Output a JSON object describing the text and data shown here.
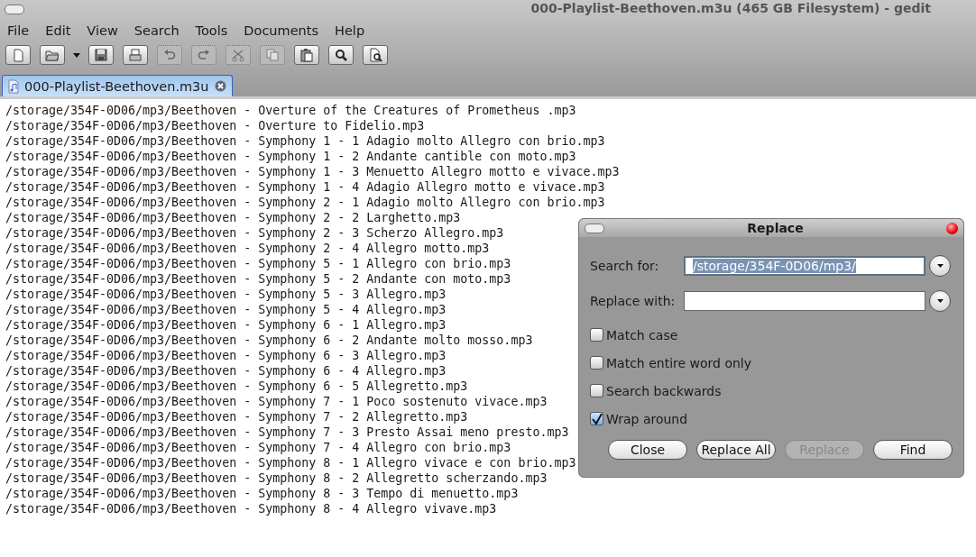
{
  "window": {
    "title": "000-Playlist-Beethoven.m3u (465 GB Filesystem) - gedit"
  },
  "menu": [
    "File",
    "Edit",
    "View",
    "Search",
    "Tools",
    "Documents",
    "Help"
  ],
  "toolbar": [
    {
      "kind": "new",
      "disabled": false
    },
    {
      "kind": "open",
      "disabled": false
    },
    {
      "kind": "dropdown",
      "disabled": false
    },
    {
      "kind": "save",
      "disabled": false
    },
    {
      "kind": "print",
      "disabled": false
    },
    {
      "kind": "undo",
      "disabled": true
    },
    {
      "kind": "redo",
      "disabled": true
    },
    {
      "kind": "cut",
      "disabled": true
    },
    {
      "kind": "copy",
      "disabled": true
    },
    {
      "kind": "paste",
      "disabled": false
    },
    {
      "kind": "find",
      "disabled": false
    },
    {
      "kind": "find-file",
      "disabled": false
    }
  ],
  "tabs": [
    {
      "label": "000-Playlist-Beethoven.m3u",
      "selected": true
    }
  ],
  "editor": {
    "lines": [
      "/storage/354F-0D06/mp3/Beethoven - Overture of the Creatures of Prometheus .mp3",
      "/storage/354F-0D06/mp3/Beethoven - Overture to Fidelio.mp3",
      "/storage/354F-0D06/mp3/Beethoven - Symphony 1 - 1 Adagio molto Allegro con brio.mp3",
      "/storage/354F-0D06/mp3/Beethoven - Symphony 1 - 2 Andante cantible con moto.mp3",
      "/storage/354F-0D06/mp3/Beethoven - Symphony 1 - 3 Menuetto Allegro motto e vivace.mp3",
      "/storage/354F-0D06/mp3/Beethoven - Symphony 1 - 4 Adagio Allegro motto e vivace.mp3",
      "/storage/354F-0D06/mp3/Beethoven - Symphony 2 - 1 Adagio molto Allegro con brio.mp3",
      "/storage/354F-0D06/mp3/Beethoven - Symphony 2 - 2 Larghetto.mp3",
      "/storage/354F-0D06/mp3/Beethoven - Symphony 2 - 3 Scherzo Allegro.mp3",
      "/storage/354F-0D06/mp3/Beethoven - Symphony 2 - 4 Allegro motto.mp3",
      "/storage/354F-0D06/mp3/Beethoven - Symphony 5 - 1 Allegro con brio.mp3",
      "/storage/354F-0D06/mp3/Beethoven - Symphony 5 - 2 Andante con moto.mp3",
      "/storage/354F-0D06/mp3/Beethoven - Symphony 5 - 3 Allegro.mp3",
      "/storage/354F-0D06/mp3/Beethoven - Symphony 5 - 4 Allegro.mp3",
      "/storage/354F-0D06/mp3/Beethoven - Symphony 6 - 1 Allegro.mp3",
      "/storage/354F-0D06/mp3/Beethoven - Symphony 6 - 2 Andante molto mosso.mp3",
      "/storage/354F-0D06/mp3/Beethoven - Symphony 6 - 3 Allegro.mp3",
      "/storage/354F-0D06/mp3/Beethoven - Symphony 6 - 4 Allegro.mp3",
      "/storage/354F-0D06/mp3/Beethoven - Symphony 6 - 5 Allegretto.mp3",
      "/storage/354F-0D06/mp3/Beethoven - Symphony 7 - 1 Poco sostenuto vivace.mp3",
      "/storage/354F-0D06/mp3/Beethoven - Symphony 7 - 2 Allegretto.mp3",
      "/storage/354F-0D06/mp3/Beethoven - Symphony 7 - 3 Presto Assai meno presto.mp3",
      "/storage/354F-0D06/mp3/Beethoven - Symphony 7 - 4 Allegro con brio.mp3",
      "/storage/354F-0D06/mp3/Beethoven - Symphony 8 - 1 Allegro vivace e con brio.mp3",
      "/storage/354F-0D06/mp3/Beethoven - Symphony 8 - 2 Allegretto scherzando.mp3",
      "/storage/354F-0D06/mp3/Beethoven - Symphony 8 - 3 Tempo di menuetto.mp3",
      "/storage/354F-0D06/mp3/Beethoven - Symphony 8 - 4 Allegro vivave.mp3"
    ]
  },
  "dialog": {
    "title": "Replace",
    "fields": [
      {
        "label": "Search for:",
        "value": "/storage/354F-0D06/mp3/",
        "focused": true
      },
      {
        "label": "Replace with:",
        "focused": false
      }
    ],
    "options": [
      {
        "label": "Match case",
        "checked": false
      },
      {
        "label": "Match entire word only",
        "checked": false
      },
      {
        "label": "Search backwards",
        "checked": false
      },
      {
        "label": "Wrap around",
        "checked": true
      }
    ],
    "buttons": [
      {
        "label": "Close",
        "disabled": false
      },
      {
        "label": "Replace All",
        "disabled": false
      },
      {
        "label": "Replace",
        "disabled": true
      },
      {
        "label": "Find",
        "disabled": false
      }
    ]
  }
}
